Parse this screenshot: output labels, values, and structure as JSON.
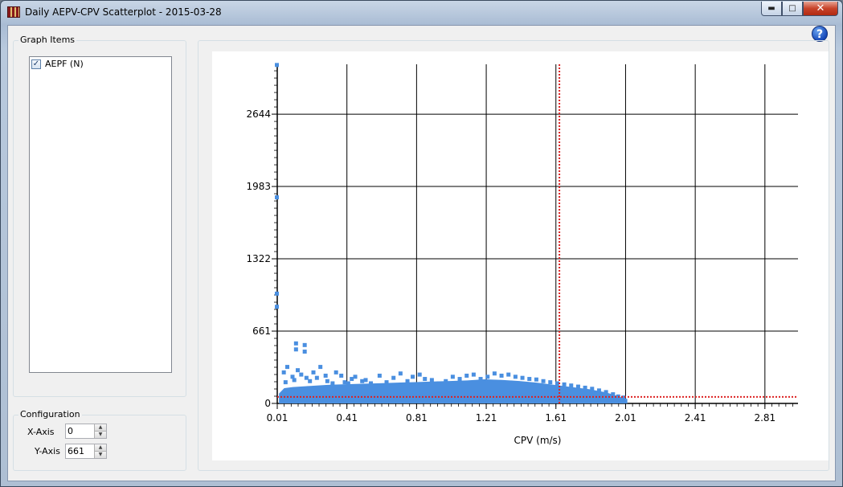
{
  "window": {
    "title": "Daily AEPV-CPV Scatterplot - 2015-03-28",
    "controls": {
      "minimize": "▬",
      "maximize": "□",
      "close": "✕"
    }
  },
  "help": {
    "glyph": "?"
  },
  "graph_items": {
    "label": "Graph Items",
    "items": [
      {
        "label": "AEPF (N)",
        "checked": true,
        "check_glyph": "✓"
      }
    ]
  },
  "configuration": {
    "label": "Configuration",
    "x_axis_label": "X-Axis",
    "x_axis_value": "0",
    "y_axis_label": "Y-Axis",
    "y_axis_value": "661"
  },
  "chart_data": {
    "type": "scatter",
    "xlabel": "CPV (m/s)",
    "ylabel": "",
    "x_ticks": [
      "0.01",
      "0.41",
      "0.81",
      "1.21",
      "1.61",
      "2.01",
      "2.41",
      "2.81"
    ],
    "y_ticks": [
      "0",
      "661",
      "1322",
      "1983",
      "2644"
    ],
    "xlim": [
      0.01,
      3.0
    ],
    "ylim": [
      0,
      3100
    ],
    "grid": true,
    "series_color": "#4a8fe0",
    "threshold_color": "#dd2222",
    "threshold_x": 1.63,
    "threshold_y": 60,
    "points": [
      [
        0.01,
        3090
      ],
      [
        0.01,
        1880
      ],
      [
        0.01,
        1000
      ],
      [
        0.01,
        880
      ],
      [
        0.12,
        545
      ],
      [
        0.12,
        490
      ],
      [
        0.17,
        530
      ],
      [
        0.17,
        470
      ],
      [
        0.07,
        330
      ],
      [
        0.05,
        280
      ],
      [
        0.1,
        240
      ],
      [
        0.13,
        300
      ],
      [
        0.06,
        190
      ],
      [
        0.11,
        210
      ],
      [
        0.15,
        260
      ],
      [
        0.18,
        230
      ],
      [
        0.2,
        200
      ],
      [
        0.22,
        280
      ],
      [
        0.24,
        230
      ],
      [
        0.26,
        330
      ],
      [
        0.29,
        250
      ],
      [
        0.3,
        200
      ],
      [
        0.33,
        180
      ],
      [
        0.35,
        280
      ],
      [
        0.38,
        250
      ],
      [
        0.4,
        190
      ],
      [
        0.42,
        180
      ],
      [
        0.44,
        220
      ],
      [
        0.46,
        240
      ],
      [
        0.5,
        200
      ],
      [
        0.52,
        210
      ],
      [
        0.55,
        180
      ],
      [
        0.6,
        250
      ],
      [
        0.64,
        190
      ],
      [
        0.68,
        230
      ],
      [
        0.72,
        270
      ],
      [
        0.76,
        200
      ],
      [
        0.79,
        240
      ],
      [
        0.83,
        260
      ],
      [
        0.86,
        220
      ],
      [
        0.9,
        210
      ],
      [
        0.94,
        180
      ],
      [
        0.98,
        200
      ],
      [
        1.02,
        240
      ],
      [
        1.06,
        220
      ],
      [
        1.1,
        250
      ],
      [
        1.14,
        260
      ],
      [
        1.18,
        220
      ],
      [
        1.22,
        240
      ],
      [
        1.26,
        270
      ],
      [
        1.3,
        250
      ],
      [
        1.34,
        260
      ],
      [
        1.38,
        240
      ],
      [
        1.42,
        230
      ],
      [
        1.46,
        220
      ],
      [
        1.5,
        215
      ],
      [
        1.54,
        200
      ],
      [
        1.58,
        190
      ],
      [
        1.62,
        180
      ],
      [
        1.66,
        170
      ],
      [
        1.7,
        160
      ],
      [
        1.74,
        150
      ],
      [
        1.78,
        140
      ],
      [
        1.82,
        130
      ],
      [
        1.86,
        115
      ],
      [
        1.9,
        100
      ],
      [
        1.94,
        80
      ],
      [
        1.97,
        60
      ],
      [
        2.0,
        50
      ]
    ],
    "band": [
      [
        0.02,
        90
      ],
      [
        0.05,
        140
      ],
      [
        0.1,
        150
      ],
      [
        0.2,
        160
      ],
      [
        0.3,
        170
      ],
      [
        0.4,
        175
      ],
      [
        0.5,
        180
      ],
      [
        0.6,
        185
      ],
      [
        0.7,
        190
      ],
      [
        0.8,
        195
      ],
      [
        0.9,
        200
      ],
      [
        1.0,
        205
      ],
      [
        1.1,
        210
      ],
      [
        1.2,
        220
      ],
      [
        1.3,
        215
      ],
      [
        1.4,
        205
      ],
      [
        1.5,
        190
      ],
      [
        1.6,
        170
      ],
      [
        1.7,
        150
      ],
      [
        1.8,
        130
      ],
      [
        1.9,
        100
      ],
      [
        1.98,
        60
      ],
      [
        2.02,
        40
      ]
    ]
  }
}
